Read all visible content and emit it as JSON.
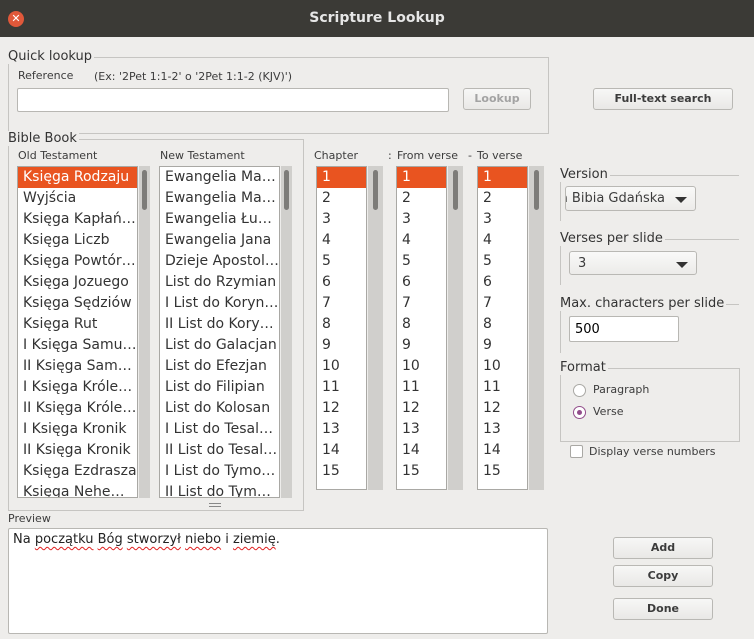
{
  "window": {
    "title": "Scripture Lookup",
    "close_icon": "close-icon"
  },
  "quick_lookup": {
    "legend": "Quick lookup",
    "reference_label": "Reference",
    "hint": "(Ex: '2Pet 1:1-2' o '2Pet 1:1-2 (KJV)')",
    "reference_value": "",
    "lookup_label": "Lookup"
  },
  "fulltext_label": "Full-text search",
  "bible_book": {
    "legend": "Bible Book",
    "old_label": "Old Testament",
    "new_label": "New Testament",
    "old_items": [
      "Księga Rodzaju",
      "Wyjścia",
      "Księga Kapłańskiego",
      "Księga Liczb",
      "Księga Powtórzonego",
      "Księga Jozuego",
      "Księga Sędziów",
      "Księga Rut",
      "I Księga Samuela",
      "II Księga Samuela",
      "I Księga Królewska",
      "II Księga Królewska",
      "I Księga Kronik",
      "II Księga Kronik",
      "Księga Ezdrasza",
      "Księga Nehemiasza"
    ],
    "new_items": [
      "Ewangelia Mateusza",
      "Ewangelia Marka",
      "Ewangelia Łukasza",
      "Ewangelia Jana",
      "Dzieje Apostolskie",
      "List do Rzymian",
      "I List do Koryntian",
      "II List do Koryntian",
      "List do Galacjan",
      "List do Efezjan",
      "List do Filipian",
      "List do Kolosan",
      "I List do Tesaloniczan",
      "II List do Tesaloniczan",
      "I List do Tymoteusza",
      "II List do Tymoteusza"
    ],
    "old_selected": 0
  },
  "chapter_label": "Chapter",
  "colon": ":",
  "from_label": "From verse",
  "dash": "-",
  "to_label": "To verse",
  "numbers": [
    "1",
    "2",
    "3",
    "4",
    "5",
    "6",
    "7",
    "8",
    "9",
    "10",
    "11",
    "12",
    "13",
    "14",
    "15"
  ],
  "version": {
    "label": "Version",
    "value": "a Bibia Gdańska"
  },
  "verses_per_slide": {
    "label": "Verses per slide",
    "value": "3"
  },
  "max_chars": {
    "label": "Max. characters per slide",
    "value": "500"
  },
  "format": {
    "label": "Format",
    "options": [
      "Paragraph",
      "Verse"
    ],
    "selected": 1
  },
  "display_verse_numbers": {
    "label": "Display verse numbers",
    "checked": false
  },
  "preview": {
    "label": "Preview",
    "words": [
      "Na",
      "początku",
      "Bóg",
      "stworzył",
      "niebo",
      "i",
      "ziemię",
      "."
    ]
  },
  "buttons": {
    "add": "Add",
    "copy": "Copy",
    "done": "Done"
  },
  "colors": {
    "accent": "#e95420",
    "titlebar": "#3b3a36",
    "radio": "#924d8b"
  }
}
